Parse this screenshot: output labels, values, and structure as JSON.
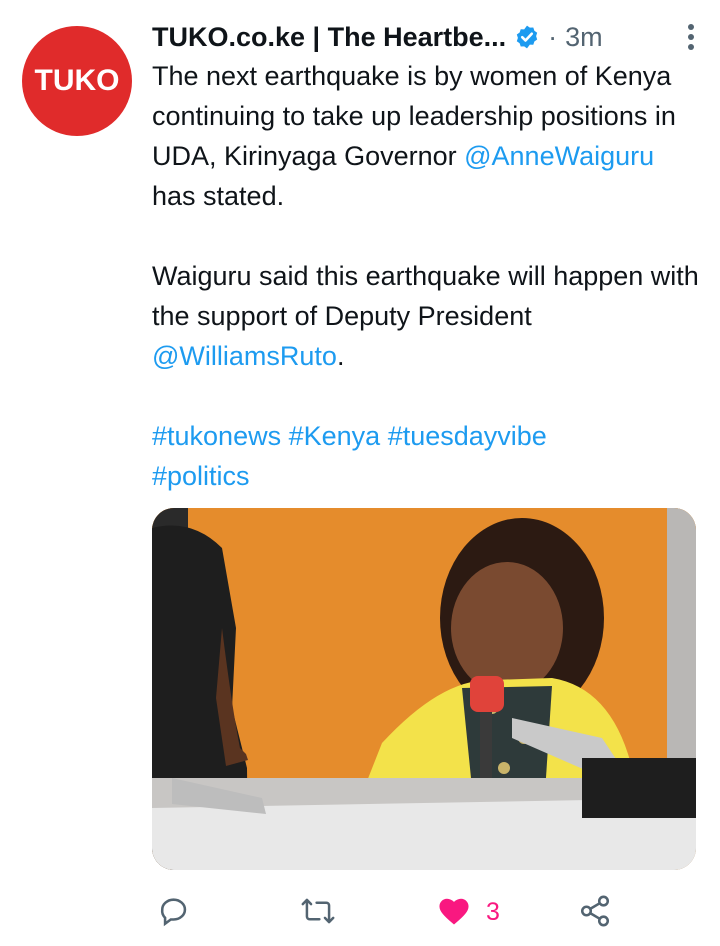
{
  "account": {
    "avatar_text": "TUKO",
    "display_name": "TUKO.co.ke | The Heartbe...",
    "separator": "·",
    "time": "3m"
  },
  "tweet": {
    "para1_part1": "The next earthquake is by women of Kenya continuing to take up leadership positions in UDA, Kirinyaga Governor ",
    "mention1": "@AnneWaiguru",
    "para1_part2": " has stated.",
    "para2_part1": "Waiguru said this earthquake will happen with the support of Deputy President ",
    "mention2": "@WilliamsRuto",
    "para2_part2": ".",
    "hashtags": [
      "#tukonews",
      "#Kenya",
      "#tuesdayvibe",
      "#politics"
    ]
  },
  "actions": {
    "like_count": "3"
  },
  "colors": {
    "brand_red": "#e02b2b",
    "link_blue": "#1d9bf0",
    "like_pink": "#f91880",
    "muted_gray": "#536471"
  },
  "icons": [
    "verified-badge-icon",
    "more-options-icon",
    "reply-icon",
    "retweet-icon",
    "like-heart-icon",
    "share-icon"
  ]
}
